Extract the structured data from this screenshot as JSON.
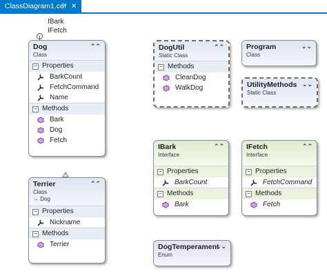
{
  "tab": {
    "title": "ClassDiagram1.cd*",
    "pin": "⊣",
    "close": "✕"
  },
  "lollipop": {
    "labels": [
      "IBark",
      "IFetch"
    ]
  },
  "shapes": {
    "dog": {
      "name": "Dog",
      "kind": "Class",
      "sections": {
        "properties": "Properties",
        "methods": "Methods"
      },
      "properties": [
        "BarkCount",
        "FetchCommand",
        "Name"
      ],
      "methods": [
        "Bark",
        "Dog",
        "Fetch"
      ]
    },
    "terrier": {
      "name": "Terrier",
      "kind": "Class",
      "base": "→ Dog",
      "sections": {
        "properties": "Properties",
        "methods": "Methods"
      },
      "properties": [
        "Nickname"
      ],
      "methods": [
        "Terrier"
      ]
    },
    "dogutil": {
      "name": "DogUtil",
      "kind": "Static Class",
      "sections": {
        "methods": "Methods"
      },
      "methods": [
        "CleanDog",
        "WalkDog"
      ]
    },
    "program": {
      "name": "Program",
      "kind": "Class"
    },
    "utility": {
      "name": "UtilityMethods",
      "kind": "Static Class"
    },
    "ibark": {
      "name": "IBark",
      "kind": "Interface",
      "sections": {
        "properties": "Properties",
        "methods": "Methods"
      },
      "properties": [
        "BarkCount"
      ],
      "methods": [
        "Bark"
      ]
    },
    "ifetch": {
      "name": "IFetch",
      "kind": "Interface",
      "sections": {
        "properties": "Properties",
        "methods": "Methods"
      },
      "properties": [
        "FetchCommand"
      ],
      "methods": [
        "Fetch"
      ]
    },
    "dogtemp": {
      "name": "DogTemperament",
      "kind": "Enum"
    }
  },
  "icons": {
    "collapse": "⌃⌃",
    "expand": "⌄⌄",
    "section_toggle": "−",
    "property": "wrench-icon",
    "method": "method-cube-icon"
  },
  "colors": {
    "accent": "#007acc",
    "class_header": "#dfe6f1",
    "interface_header": "#dfeccf",
    "enum_header": "#e4dff0"
  }
}
